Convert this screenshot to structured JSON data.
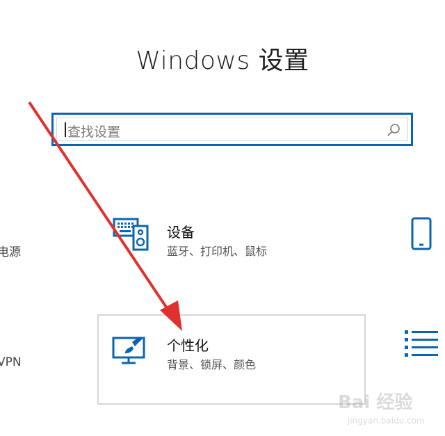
{
  "header": {
    "title": "Windows 设置"
  },
  "search": {
    "placeholder": "查找设置"
  },
  "left_partial": {
    "item1": "电源",
    "item2": "VPN"
  },
  "tiles": {
    "devices": {
      "title": "设备",
      "subtitle": "蓝牙、打印机、鼠标"
    },
    "personalization": {
      "title": "个性化",
      "subtitle": "背景、锁屏、颜色"
    }
  },
  "right_partial": {
    "phone_icon": "phone-icon",
    "list_icon": "list-icon"
  },
  "watermark": {
    "line1": "Bai 经验",
    "line2": "jingyan.baidu.com"
  },
  "colors": {
    "accent": "#0a64b4",
    "arrow": "#e03030"
  }
}
